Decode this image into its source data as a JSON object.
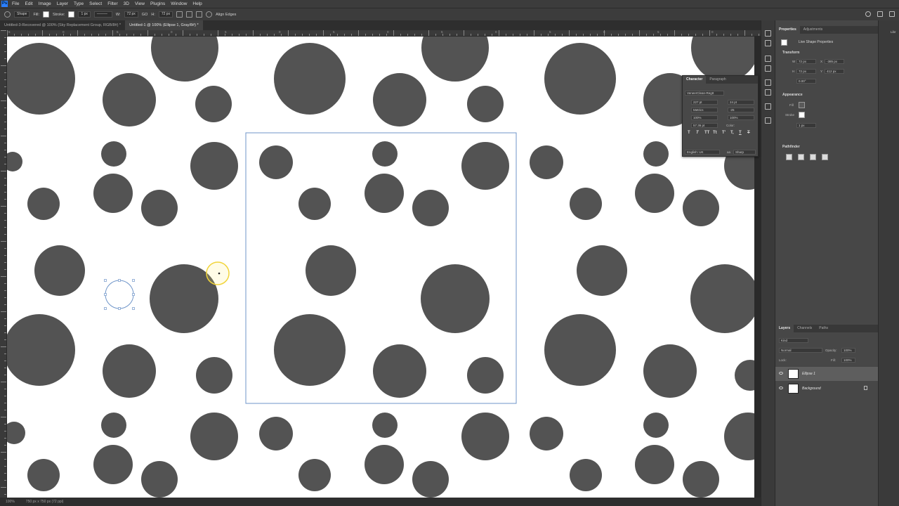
{
  "menubar": {
    "logo": "Ps",
    "items": [
      "File",
      "Edit",
      "Image",
      "Layer",
      "Type",
      "Select",
      "Filter",
      "3D",
      "View",
      "Plugins",
      "Window",
      "Help"
    ]
  },
  "options": {
    "tool_mode": "Shape",
    "fill_label": "Fill:",
    "stroke_label": "Stroke:",
    "stroke_width": "1 px",
    "w_label": "W:",
    "w_value": "72 px",
    "go_label": "GO",
    "h_label": "H:",
    "h_value": "72 px",
    "align_edges": "Align Edges"
  },
  "tabs": [
    {
      "label": "Untitled-3-Recovered @ 100% (Sky Replacement Group, RGB/8#) *",
      "active": false
    },
    {
      "label": "Untitled-1 @ 100% (Ellipse 1, Gray/8#) *",
      "active": true
    }
  ],
  "ruler_top_labels": [
    "5",
    "0",
    "5",
    "0",
    "5",
    "0",
    "5",
    "0",
    "5",
    "0",
    "5",
    "0",
    "5",
    "0"
  ],
  "status": {
    "zoom": "100%",
    "doc_size": "750 px x 750 px (72 ppi)"
  },
  "colors": {
    "dot": "#535353",
    "canvas": "#ffffff",
    "selection": "#6f95c9",
    "cursor_ring": "#f1d43a"
  },
  "properties": {
    "tabs": [
      "Properties",
      "Adjustments"
    ],
    "header": "Live Shape Properties",
    "transform_title": "Transform",
    "w": "72 px",
    "x": "-385 px",
    "h": "72 px",
    "y": "412 px",
    "angle": "0.00°",
    "appearance_title": "Appearance",
    "fill_label": "Fill",
    "stroke_label": "Stroke",
    "stroke_width": "1 px",
    "pathfinder_title": "Pathfinder"
  },
  "character": {
    "tabs": [
      "Character",
      "Paragraph"
    ],
    "font": "VeneerClean-RegIt",
    "size": "227 pt",
    "leading": "24 pt",
    "kerning": "Metrics",
    "tracking": "-25",
    "v_scale": "100%",
    "h_scale": "100%",
    "baseline": "57.36 pt",
    "color_label": "Color:",
    "language": "English: UK",
    "aa": "aa",
    "antialias": "Sharp",
    "style_glyphs": [
      "T",
      "T",
      "TT",
      "Tt",
      "T'",
      "T,",
      "T",
      "T"
    ]
  },
  "layers": {
    "tabs": [
      "Layers",
      "Channels",
      "Paths"
    ],
    "filter": "Kind",
    "blend": "Normal",
    "opacity_label": "Opacity:",
    "opacity": "100%",
    "lock_label": "Lock:",
    "fill_label": "Fill:",
    "fill": "100%",
    "items": [
      {
        "name": "Ellipse 1",
        "selected": true
      },
      {
        "name": "Background",
        "selected": false
      }
    ]
  },
  "libraries_label": "Libr"
}
